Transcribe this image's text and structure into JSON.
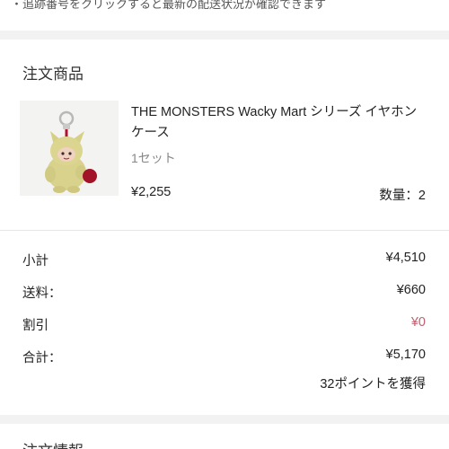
{
  "notice": {
    "text": "・追跡番号をクリックすると最新の配送状況が確認できます"
  },
  "order_items": {
    "title": "注文商品",
    "product": {
      "image_alt": "yellow monster plush keychain",
      "name": "THE MONSTERS Wacky Mart シリーズ イヤホンケース",
      "set": "1セット",
      "price": "¥2,255",
      "quantity": "数量：2"
    }
  },
  "summary": {
    "rows": [
      {
        "label": "小計",
        "value": "¥4,510"
      },
      {
        "label": "送料：",
        "value": "¥660"
      },
      {
        "label": "割引",
        "value": "¥0"
      },
      {
        "label": "合計：",
        "value": "¥5,170"
      }
    ],
    "points": "32ポイントを獲得",
    "discount_color": "#c0606e"
  },
  "next_section": {
    "title": "注文情報"
  }
}
